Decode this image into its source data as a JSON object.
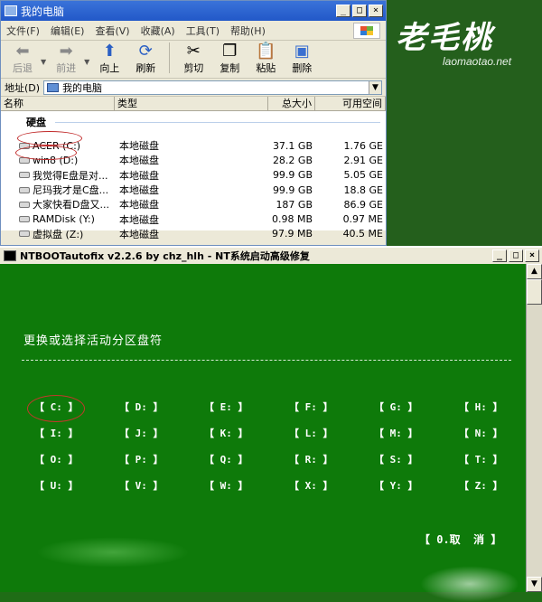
{
  "logo": {
    "text": "老毛桃",
    "url": "laomaotao.net"
  },
  "explorer": {
    "title": "我的电脑",
    "menu": [
      "文件(F)",
      "编辑(E)",
      "查看(V)",
      "收藏(A)",
      "工具(T)",
      "帮助(H)"
    ],
    "toolbar": {
      "back": "后退",
      "forward": "前进",
      "up": "向上",
      "refresh": "刷新",
      "cut": "剪切",
      "copy": "复制",
      "paste": "粘贴",
      "delete": "删除"
    },
    "address_label": "地址(D)",
    "address_value": "我的电脑",
    "columns": [
      "名称",
      "类型",
      "总大小",
      "可用空间"
    ],
    "group": "硬盘",
    "drives": [
      {
        "name": "ACER (C:)",
        "type": "本地磁盘",
        "total": "37.1 GB",
        "free": "1.76 GE"
      },
      {
        "name": "win8 (D:)",
        "type": "本地磁盘",
        "total": "28.2 GB",
        "free": "2.91 GE"
      },
      {
        "name": "我觉得E盘是对...",
        "type": "本地磁盘",
        "total": "99.9 GB",
        "free": "5.05 GE"
      },
      {
        "name": "尼玛我才是C盘...",
        "type": "本地磁盘",
        "total": "99.9 GB",
        "free": "18.8 GE"
      },
      {
        "name": "大家快看D盘又...",
        "type": "本地磁盘",
        "total": "187 GB",
        "free": "86.9 GE"
      },
      {
        "name": "RAMDisk (Y:)",
        "type": "本地磁盘",
        "total": "0.98 MB",
        "free": "0.97 ME"
      },
      {
        "name": "虚拟盘 (Z:)",
        "type": "本地磁盘",
        "total": "97.9 MB",
        "free": "40.5 ME"
      }
    ]
  },
  "ntboot": {
    "title": "NTBOOTautofix v2.2.6 by chz_hlh - NT系统启动高级修复",
    "heading": "更换或选择活动分区盘符",
    "drive_letters": [
      [
        "【 C: 】",
        "【 D: 】",
        "【 E: 】",
        "【 F: 】",
        "【 G: 】",
        "【 H: 】"
      ],
      [
        "【 I: 】",
        "【 J: 】",
        "【 K: 】",
        "【 L: 】",
        "【 M: 】",
        "【 N: 】"
      ],
      [
        "【 O: 】",
        "【 P: 】",
        "【 Q: 】",
        "【 R: 】",
        "【 S: 】",
        "【 T: 】"
      ],
      [
        "【 U: 】",
        "【 V: 】",
        "【 W: 】",
        "【 X: 】",
        "【 Y: 】",
        "【 Z: 】"
      ]
    ],
    "cancel": "【 0.取  消 】"
  },
  "colors": {
    "console_bg": "#0e7a0a",
    "title_bar": "#2258c8",
    "highlight_circle": "#c12a2a"
  }
}
